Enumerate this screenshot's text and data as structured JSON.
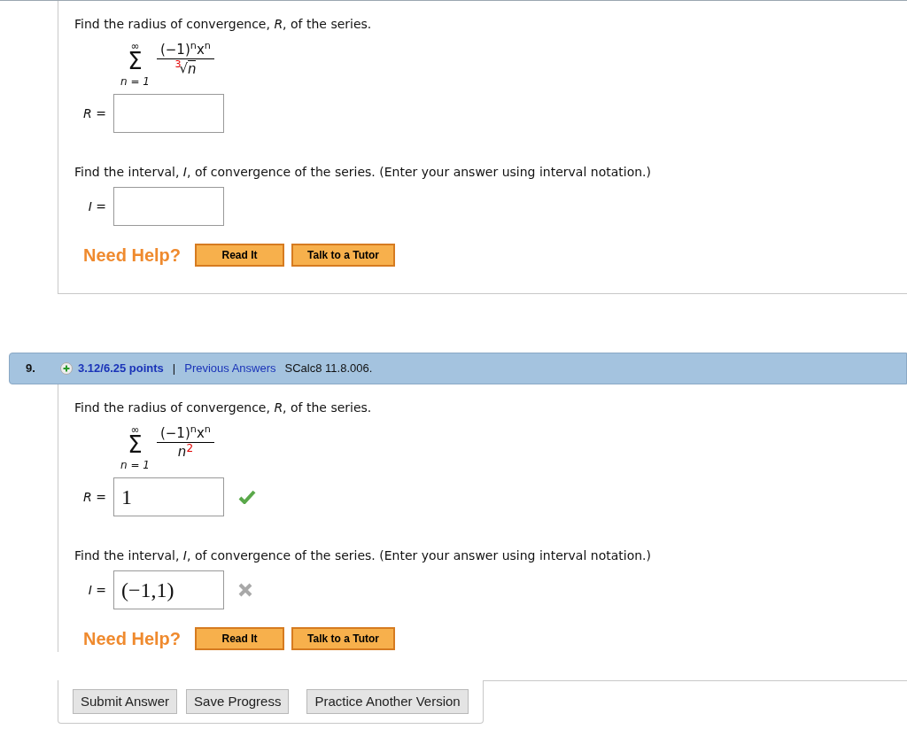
{
  "questions": [
    {
      "prompt_1": "Find the radius of convergence, *R*, of the series.",
      "series": {
        "sign": "Σ",
        "upper": "∞",
        "lower": "n = 1",
        "numerator": "(−1)$^{n}$x$^{n}$",
        "kind": "root",
        "root_index": "3",
        "radical": "√",
        "denominator": "n"
      },
      "answer_1": {
        "label": "*R* ="
      },
      "prompt_2": "Find the interval, *I*, of convergence of the series. (Enter your answer using interval notation.)",
      "answer_2": {
        "label": "*I* ="
      },
      "help": {
        "label": "Need Help?",
        "buttons": [
          "Read It",
          "Talk to a Tutor"
        ]
      }
    },
    {
      "header": {
        "number": "9.",
        "points": "3.12/6.25 points",
        "separator": "|",
        "link": "Previous Answers",
        "source": "SCalc8 11.8.006."
      },
      "prompt_1": "Find the radius of convergence, *R*, of the series.",
      "series": {
        "sign": "Σ",
        "upper": "∞",
        "lower": "n = 1",
        "numerator": "(−1)$^{n}$x$^{n}$",
        "kind": "power",
        "denominator": "n",
        "exponent": "2"
      },
      "answer_1": {
        "label": "*R* =",
        "value": "1",
        "correct": true
      },
      "prompt_2": "Find the interval, *I*, of convergence of the series. (Enter your answer using interval notation.)",
      "answer_2": {
        "label": "*I* =",
        "value": "(−1,1)",
        "correct": false
      },
      "help": {
        "label": "Need Help?",
        "buttons": [
          "Read It",
          "Talk to a Tutor"
        ]
      },
      "actions": [
        "Submit Answer",
        "Save Progress",
        "Practice Another Version"
      ]
    }
  ]
}
